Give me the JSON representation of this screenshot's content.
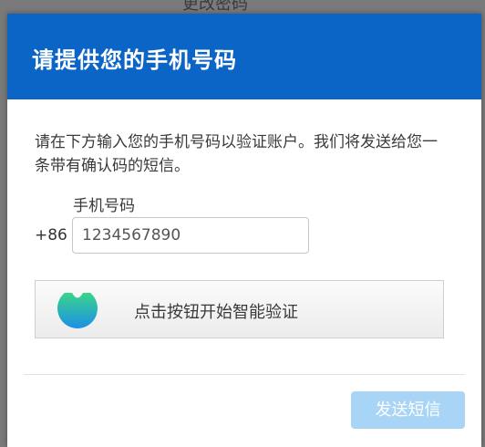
{
  "background": {
    "partial_title": "更改密码"
  },
  "modal": {
    "title": "请提供您的手机号码",
    "description": "请在下方输入您的手机号码以验证账户。我们将发送给您一条带有确认码的短信。",
    "phone_label": "手机号码",
    "country_code": "+86",
    "phone_value": "1234567890",
    "verify_button_label": "点击按钮开始智能验证",
    "send_button_label": "发送短信"
  },
  "colors": {
    "header": "#0b65c6",
    "send_button_disabled": "#a8d4f5",
    "logo_top": "#39d58a",
    "logo_bottom": "#1e8fe6"
  },
  "icons": {
    "verify": "smart-verify-logo-icon"
  }
}
